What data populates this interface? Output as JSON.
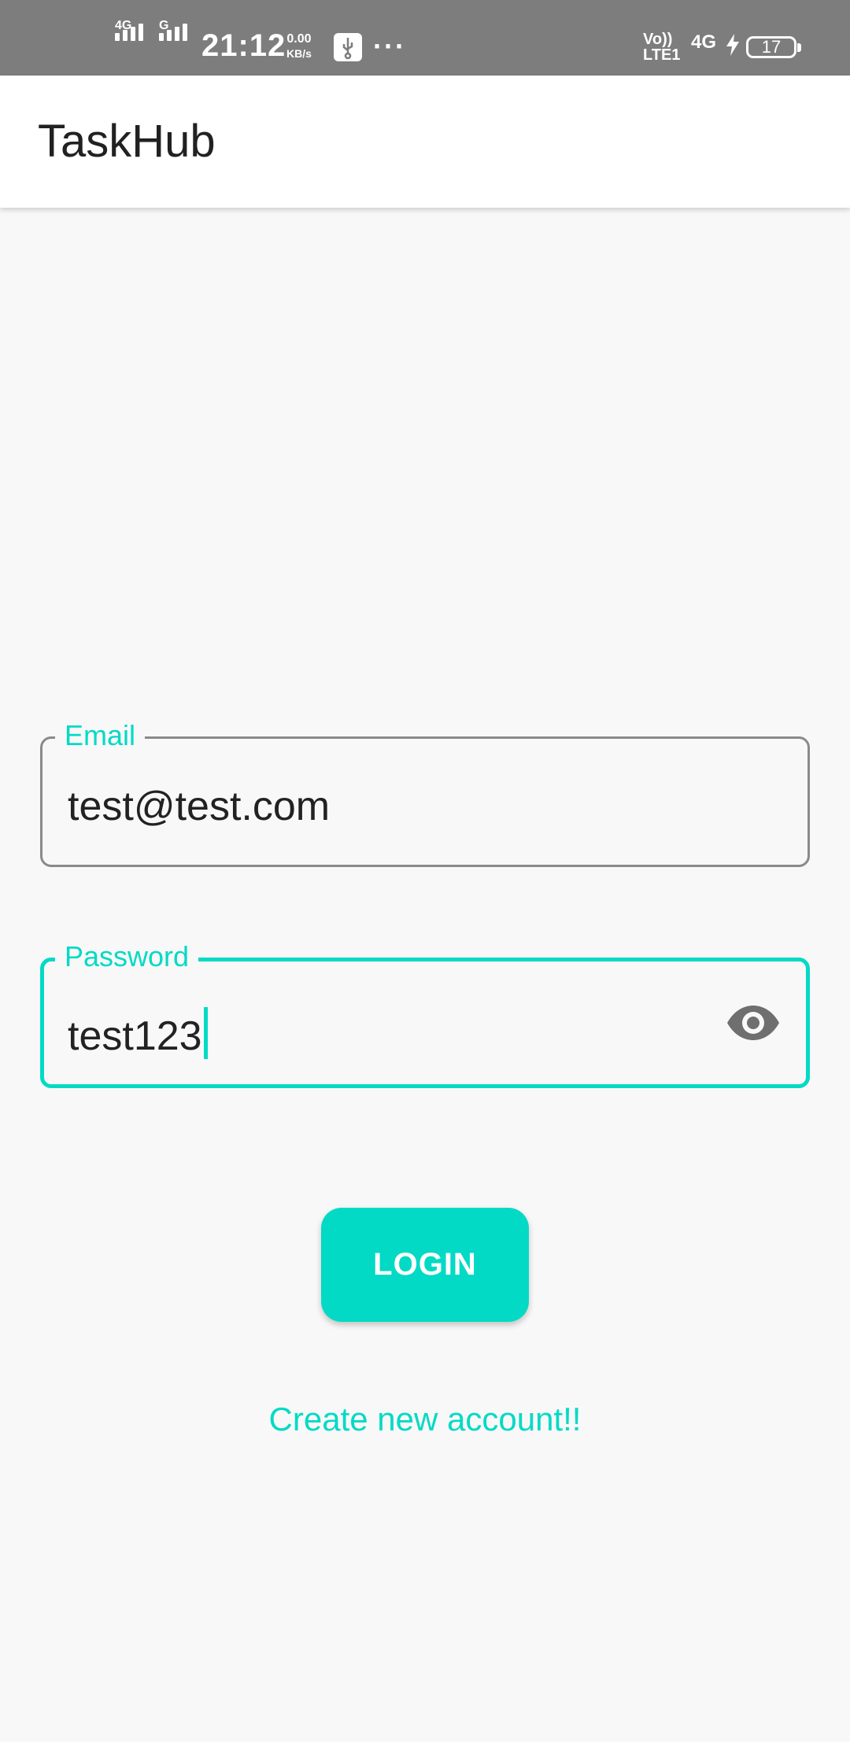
{
  "status_bar": {
    "sim1_type": "4G",
    "sim2_type": "G",
    "time": "21:12",
    "speed_value": "0.00",
    "speed_unit": "KB/s",
    "volte_line1": "Vo))",
    "volte_line2": "LTE1",
    "network": "4G",
    "battery": "17",
    "icons": [
      "signal-icon",
      "usb-icon",
      "more-dots-icon",
      "charging-icon",
      "battery-icon"
    ]
  },
  "app_bar": {
    "title": "TaskHub"
  },
  "login_form": {
    "email": {
      "label": "Email",
      "value": "test@test.com"
    },
    "password": {
      "label": "Password",
      "value": "test123",
      "toggle_icon": "eye-icon"
    },
    "login_label": "LOGIN",
    "create_account_label": "Create new account!!"
  },
  "colors": {
    "accent": "#03dac5",
    "status_bar": "#7d7d7d",
    "background": "#f8f8f8",
    "app_bar": "#ffffff"
  }
}
